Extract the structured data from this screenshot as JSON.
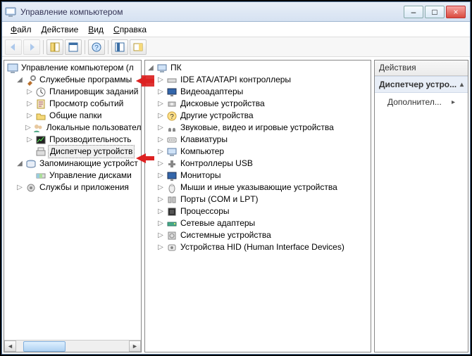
{
  "window": {
    "title": "Управление компьютером",
    "btn_min": "–",
    "btn_max": "□",
    "btn_close": "×"
  },
  "menu": {
    "file": {
      "full": "Файл",
      "u": "Ф",
      "rest": "айл"
    },
    "action": {
      "full": "Действие",
      "u": "Д",
      "rest": "ействие"
    },
    "view": {
      "full": "Вид",
      "u": "В",
      "rest": "ид"
    },
    "help": {
      "full": "Справка",
      "u": "С",
      "rest": "правка"
    }
  },
  "left_tree": {
    "root": "Управление компьютером (л",
    "g1": "Служебные программы",
    "i1a": "Планировщик заданий",
    "i1b": "Просмотр событий",
    "i1c": "Общие папки",
    "i1d": "Локальные пользователи",
    "i1e": "Производительность",
    "i1f": "Диспетчер устройств",
    "g2": "Запоминающие устройст",
    "i2a": "Управление дисками",
    "g3": "Службы и приложения"
  },
  "mid_tree": {
    "root": "ПК",
    "items": [
      "IDE ATA/ATAPI контроллеры",
      "Видеоадаптеры",
      "Дисковые устройства",
      "Другие устройства",
      "Звуковые, видео и игровые устройства",
      "Клавиатуры",
      "Компьютер",
      "Контроллеры USB",
      "Мониторы",
      "Мыши и иные указывающие устройства",
      "Порты (COM и LPT)",
      "Процессоры",
      "Сетевые адаптеры",
      "Системные устройства",
      "Устройства HID (Human Interface Devices)"
    ]
  },
  "actions": {
    "header": "Действия",
    "selected": "Диспетчер устро...",
    "more": "Дополнител..."
  },
  "glyphs": {
    "tri_right": "▷",
    "tri_down": "◢",
    "chev_up": "▴",
    "chev_right": "▸",
    "arr_left": "◄",
    "arr_right": "►"
  }
}
